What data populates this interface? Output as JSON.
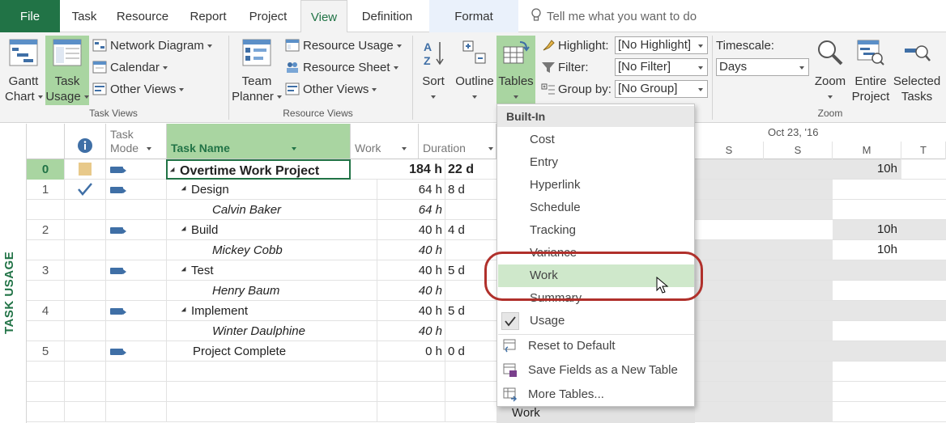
{
  "tabs": [
    "File",
    "Task",
    "Resource",
    "Report",
    "Project",
    "View",
    "Definition",
    "Format"
  ],
  "active_tab": "View",
  "tell_me": "Tell me what you want to do",
  "ribbon": {
    "gantt_chart": [
      "Gantt",
      "Chart"
    ],
    "task_usage": [
      "Task",
      "Usage"
    ],
    "network_diagram": "Network Diagram",
    "calendar": "Calendar",
    "other_views": "Other Views",
    "task_views_label": "Task Views",
    "team_planner": [
      "Team",
      "Planner"
    ],
    "resource_usage": "Resource Usage",
    "resource_sheet": "Resource Sheet",
    "other_views_2": "Other Views",
    "resource_views_label": "Resource Views",
    "sort": "Sort",
    "outline": "Outline",
    "tables": "Tables",
    "highlight_label": "Highlight:",
    "highlight_value": "[No Highlight]",
    "filter_label": "Filter:",
    "filter_value": "[No Filter]",
    "groupby_label": "Group by:",
    "groupby_value": "[No Group]",
    "timescale_label": "Timescale:",
    "timescale_value": "Days",
    "zoom": "Zoom",
    "entire_project": [
      "Entire",
      "Project"
    ],
    "selected_tasks": [
      "Selected",
      "Tasks"
    ],
    "zoom_label": "Zoom"
  },
  "side_label": "TASK USAGE",
  "columns": {
    "task_mode": [
      "Task",
      "Mode"
    ],
    "task_name": "Task Name",
    "work": "Work",
    "duration": "Duration"
  },
  "timeline": {
    "date_label": "Oct 23, '16",
    "days": [
      "S",
      "S",
      "M",
      "T"
    ],
    "values": [
      "10h",
      "10h",
      "10h"
    ],
    "bottom_label": "Work"
  },
  "rows": [
    {
      "id": "0",
      "name": "Overtime Work Project",
      "work": "184 h",
      "duration": "22 d"
    },
    {
      "id": "1",
      "name": "Design",
      "work": "64 h",
      "duration": "8 d"
    },
    {
      "id": "",
      "name": "Calvin Baker",
      "work": "64 h",
      "duration": ""
    },
    {
      "id": "2",
      "name": "Build",
      "work": "40 h",
      "duration": "4 d"
    },
    {
      "id": "",
      "name": "Mickey Cobb",
      "work": "40 h",
      "duration": ""
    },
    {
      "id": "3",
      "name": "Test",
      "work": "40 h",
      "duration": "5 d"
    },
    {
      "id": "",
      "name": "Henry Baum",
      "work": "40 h",
      "duration": ""
    },
    {
      "id": "4",
      "name": "Implement",
      "work": "40 h",
      "duration": "5 d"
    },
    {
      "id": "",
      "name": "Winter Daulphine",
      "work": "40 h",
      "duration": ""
    },
    {
      "id": "5",
      "name": "Project Complete",
      "work": "0 h",
      "duration": "0 d"
    }
  ],
  "dropdown": {
    "header": "Built-In",
    "items": [
      "Cost",
      "Entry",
      "Hyperlink",
      "Schedule",
      "Tracking",
      "Variance",
      "Work",
      "Summary",
      "Usage"
    ],
    "commands": [
      "Reset to Default",
      "Save Fields as a New Table",
      "More Tables..."
    ]
  },
  "colors": {
    "accent": "#217346",
    "highlight": "#a9d5a1",
    "annotation": "#b0302b"
  }
}
